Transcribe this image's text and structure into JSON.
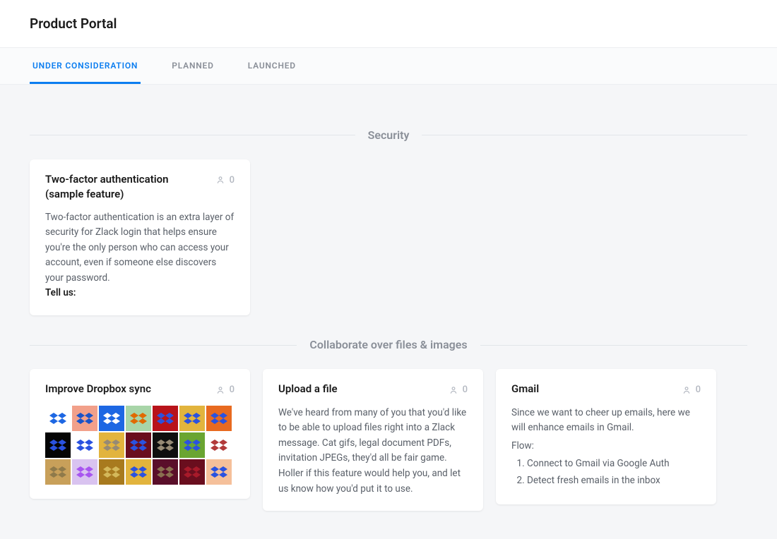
{
  "header": {
    "title": "Product Portal"
  },
  "tabs": [
    {
      "label": "UNDER CONSIDERATION",
      "active": true
    },
    {
      "label": "PLANNED",
      "active": false
    },
    {
      "label": "LAUNCHED",
      "active": false
    }
  ],
  "sections": [
    {
      "title": "Security",
      "cards": [
        {
          "title": "Two-factor authentication (sample feature)",
          "votes": "0",
          "body_text": "Two-factor authentication is an extra layer of security for Zlack login that helps ensure you're the only person who can access your account, even if someone else discovers your password.",
          "body_bold": "Tell us:"
        }
      ]
    },
    {
      "title": "Collaborate over files & images",
      "cards": [
        {
          "title": "Improve Dropbox sync",
          "votes": "0",
          "type": "thumbs",
          "thumbs": [
            {
              "bg": "#ffffff",
              "fg": "#1d67e3"
            },
            {
              "bg": "#f2a08a",
              "fg": "#1953c8"
            },
            {
              "bg": "#1d67e3",
              "fg": "#ffffff"
            },
            {
              "bg": "#a8d5a8",
              "fg": "#e06a00"
            },
            {
              "bg": "#b8131a",
              "fg": "#2a52e0"
            },
            {
              "bg": "#e2b43d",
              "fg": "#2a52e0"
            },
            {
              "bg": "#e86a20",
              "fg": "#2a52e0"
            },
            {
              "bg": "#050505",
              "fg": "#2a52e0"
            },
            {
              "bg": "#ffffff",
              "fg": "#2a52e0"
            },
            {
              "bg": "#e2b43d",
              "fg": "#968a75"
            },
            {
              "bg": "#6a0e1e",
              "fg": "#2a52e0"
            },
            {
              "bg": "#0f0f0f",
              "fg": "#968a75"
            },
            {
              "bg": "#6aa532",
              "fg": "#2a52e0"
            },
            {
              "bg": "#ffffff",
              "fg": "#b23a3a"
            },
            {
              "bg": "#c8a05a",
              "fg": "#8f7a4a"
            },
            {
              "bg": "#d9c3f0",
              "fg": "#a855f0"
            },
            {
              "bg": "#a87a1e",
              "fg": "#d4b85a"
            },
            {
              "bg": "#e2b43d",
              "fg": "#2a52e0"
            },
            {
              "bg": "#5a0f2a",
              "fg": "#8a7050"
            },
            {
              "bg": "#6a0e1e",
              "fg": "#a81a2a"
            },
            {
              "bg": "#f5c09a",
              "fg": "#2a52e0"
            }
          ]
        },
        {
          "title": "Upload a file",
          "votes": "0",
          "type": "text",
          "body_text": "We've heard from many of you that you'd like to be able to upload files right into a Zlack message. Cat gifs, legal document PDFs, invitation JPEGs, they'd all be fair game. Holler if this feature would help you, and let us know how you'd put it to use."
        },
        {
          "title": "Gmail",
          "votes": "0",
          "type": "flow",
          "body_text": "Since we want to cheer up emails, here we will enhance emails in Gmail.",
          "flow_label": "Flow:",
          "flow": [
            "Connect to Gmail via Google Auth",
            "Detect fresh emails in the inbox"
          ]
        }
      ]
    }
  ]
}
